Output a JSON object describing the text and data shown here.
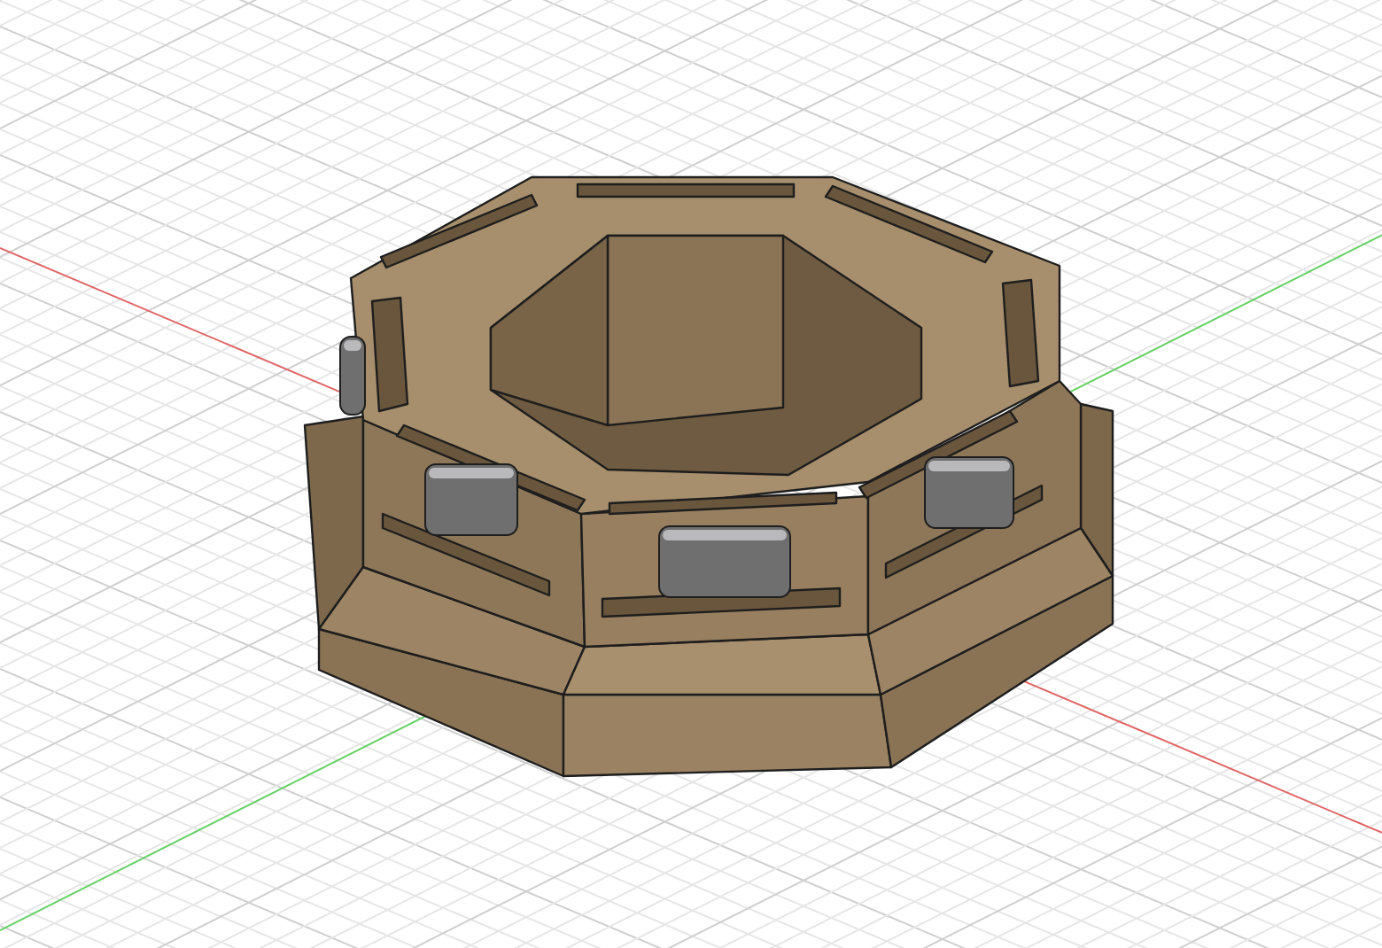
{
  "viewport": {
    "axes": [
      {
        "kind": "x",
        "color": "#e06666"
      },
      {
        "kind": "y",
        "color": "#66d066"
      }
    ]
  }
}
